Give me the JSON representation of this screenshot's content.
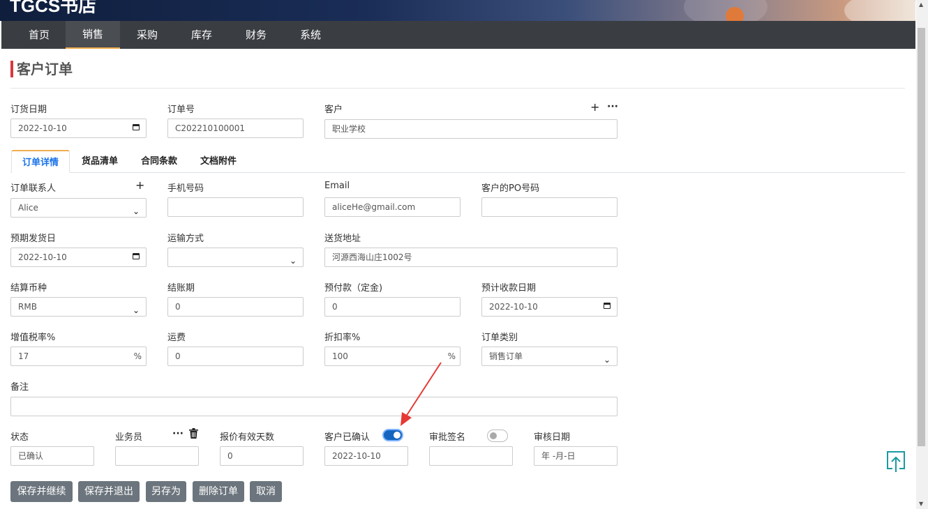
{
  "brand": "TGCS书店",
  "nav": {
    "items": [
      "首页",
      "销售",
      "采购",
      "库存",
      "财务",
      "系统"
    ],
    "active_index": 1
  },
  "page_title": "客户订单",
  "header_fields": {
    "order_date": {
      "label": "订货日期",
      "value": "2022-10-10"
    },
    "order_no": {
      "label": "订单号",
      "value": "C202210100001"
    },
    "customer": {
      "label": "客户",
      "value": "职业学校"
    }
  },
  "tabs": [
    "订单详情",
    "货品清单",
    "合同条款",
    "文档附件"
  ],
  "active_tab": 0,
  "detail": {
    "contact": {
      "label": "订单联系人",
      "value": "Alice"
    },
    "phone": {
      "label": "手机号码",
      "value": ""
    },
    "email": {
      "label": "Email",
      "value": "aliceHe@gmail.com"
    },
    "po": {
      "label": "客户的PO号码",
      "value": ""
    },
    "ship_date": {
      "label": "预期发货日",
      "value": "2022-10-10"
    },
    "shipping": {
      "label": "运输方式",
      "value": ""
    },
    "address": {
      "label": "送货地址",
      "value": "河源西海山庄1002号"
    },
    "currency": {
      "label": "结算币种",
      "value": "RMB"
    },
    "payment_terms": {
      "label": "结账期",
      "value": "0"
    },
    "prepayment": {
      "label": "预付款（定金)",
      "value": "0"
    },
    "receipt_date": {
      "label": "预计收款日期",
      "value": "2022-10-10"
    },
    "vat": {
      "label": "增值税率%",
      "value": "17",
      "unit": "%"
    },
    "freight": {
      "label": "运费",
      "value": "0"
    },
    "discount": {
      "label": "折扣率%",
      "value": "100",
      "unit": "%"
    },
    "order_type": {
      "label": "订单类别",
      "value": "销售订单"
    },
    "remarks": {
      "label": "备注",
      "value": ""
    }
  },
  "status_row": {
    "status": {
      "label": "状态",
      "value": "已确认"
    },
    "salesperson": {
      "label": "业务员",
      "value": ""
    },
    "quote_days": {
      "label": "报价有效天数",
      "value": "0"
    },
    "customer_confirmed": {
      "label": "客户已确认",
      "on": true,
      "value": "2022-10-10"
    },
    "approval_sign": {
      "label": "审批签名",
      "on": false,
      "value": ""
    },
    "approval_date": {
      "label": "审核日期",
      "placeholder": "年 -月-日"
    }
  },
  "buttons": [
    "保存并继续",
    "保存并退出",
    "另存为",
    "删除订单",
    "取消"
  ],
  "icons": {
    "plus": "+",
    "more": "···",
    "trash": "trash-icon",
    "upload": "upload-icon"
  },
  "colors": {
    "nav_bg": "#3a3d42",
    "accent": "#f0ad4e",
    "title_bar": "#d9393e",
    "toggle_on": "#1565c0",
    "button": "#6c757d",
    "annotation_arrow": "#e53935"
  }
}
